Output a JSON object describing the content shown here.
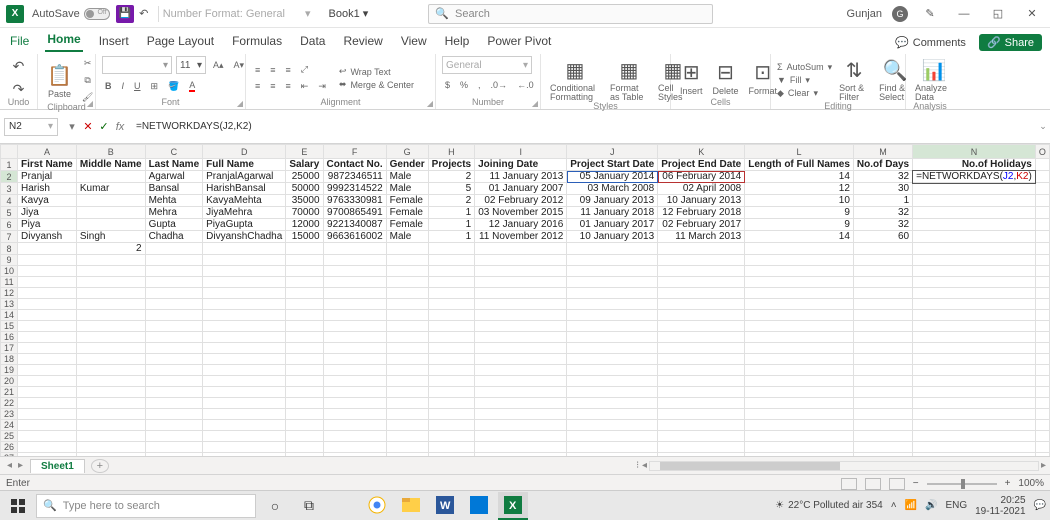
{
  "title": {
    "autosave": "AutoSave",
    "book": "Book1",
    "nf_label": "Number Format: General",
    "search_ph": "Search",
    "user": "Gunjan",
    "user_initial": "G"
  },
  "tabs": {
    "file": "File",
    "items": [
      "Home",
      "Insert",
      "Page Layout",
      "Formulas",
      "Data",
      "Review",
      "View",
      "Help",
      "Power Pivot"
    ],
    "comments": "Comments",
    "share": "Share"
  },
  "ribbon": {
    "undo": "Undo",
    "paste": "Paste",
    "clipboard": "Clipboard",
    "font_size": "11",
    "font": "Font",
    "wrap": "Wrap Text",
    "merge": "Merge & Center",
    "alignment": "Alignment",
    "nf": "General",
    "number": "Number",
    "cond": "Conditional Formatting",
    "fat": "Format as Table",
    "cstyles": "Cell Styles",
    "styles": "Styles",
    "insert": "Insert",
    "delete": "Delete",
    "format": "Format",
    "cells": "Cells",
    "autosum": "AutoSum",
    "fill": "Fill",
    "clear": "Clear",
    "sort": "Sort & Filter",
    "find": "Find & Select",
    "editing": "Editing",
    "analyze": "Analyze Data",
    "analysis": "Analysis"
  },
  "fbar": {
    "ref": "N2",
    "formula": "=NETWORKDAYS(J2,K2)"
  },
  "cols": [
    "A",
    "B",
    "C",
    "D",
    "E",
    "F",
    "G",
    "H",
    "I",
    "J",
    "K",
    "L",
    "M",
    "N",
    "O"
  ],
  "widths": [
    85,
    60,
    45,
    70,
    65,
    55,
    35,
    35,
    105,
    85,
    85,
    85,
    60,
    95,
    30
  ],
  "headers": [
    "First Name",
    "Middle Name",
    "Last Name",
    "Full Name",
    "Salary",
    "Contact No.",
    "Gender",
    "Projects",
    "Joining Date",
    "Project Start Date",
    "Project End Date",
    "Length of Full Names",
    "No.of Days",
    "No.of Holidays",
    ""
  ],
  "rows": [
    [
      "Pranjal",
      "",
      "Agarwal",
      "PranjalAgarwal",
      "25000",
      "9872346511",
      "Male",
      "2",
      "11 January 2013",
      "05 January 2014",
      "06 February 2014",
      "14",
      "32",
      ""
    ],
    [
      "Harish",
      "Kumar",
      "Bansal",
      "HarishBansal",
      "50000",
      "9992314522",
      "Male",
      "5",
      "01 January 2007",
      "03 March 2008",
      "02 April 2008",
      "12",
      "30",
      ""
    ],
    [
      "Kavya",
      "",
      "Mehta",
      "KavyaMehta",
      "35000",
      "9763330981",
      "Female",
      "2",
      "02 February 2012",
      "09 January 2013",
      "10 January 2013",
      "10",
      "1",
      ""
    ],
    [
      "Jiya",
      "",
      "Mehra",
      "JiyaMehra",
      "70000",
      "9700865491",
      "Female",
      "1",
      "03 November 2015",
      "11 January 2018",
      "12 February 2018",
      "9",
      "32",
      ""
    ],
    [
      "Piya",
      "",
      "Gupta",
      "PiyaGupta",
      "12000",
      "9221340087",
      "Female",
      "1",
      "12 January 2016",
      "01 January 2017",
      "02 February 2017",
      "9",
      "32",
      ""
    ],
    [
      "Divyansh",
      "Singh",
      "Chadha",
      "DivyanshChadha",
      "15000",
      "9663616002",
      "Male",
      "1",
      "11 November 2012",
      "10 January 2013",
      "11 March 2013",
      "14",
      "60",
      ""
    ]
  ],
  "b8": "2",
  "n2_disp_pre": "=NETWORKDAYS(",
  "n2_j": "J2",
  "n2_c": ",",
  "n2_k": "K2",
  "n2_post": ")",
  "sheet": "Sheet1",
  "status": {
    "mode": "Enter",
    "zoom": "100%"
  },
  "task": {
    "search": "Type here to search",
    "weather": "22°C  Polluted air 354",
    "lang": "ENG",
    "time": "20:25",
    "date": "19-11-2021"
  }
}
